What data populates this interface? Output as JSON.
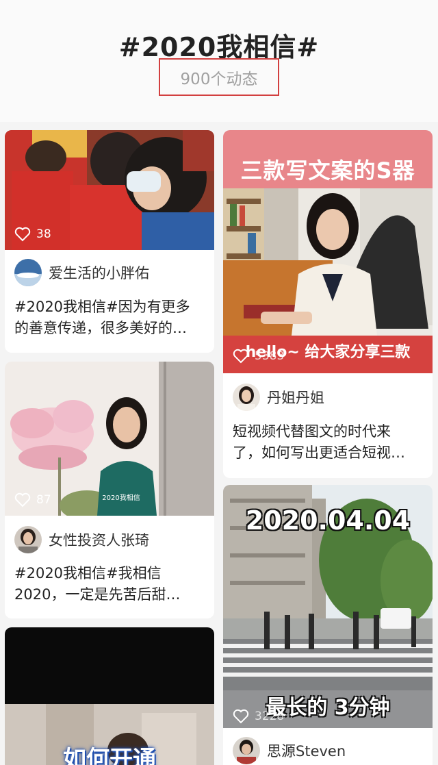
{
  "topic": {
    "title": "#2020我相信#",
    "post_count": "900个动态"
  },
  "left_column": [
    {
      "likes": "38",
      "author": "爱生活的小胖佑",
      "caption_lines": [
        "#2020我相信#因为有更多",
        "的善意传递，很多美好的…"
      ]
    },
    {
      "likes": "87",
      "video_tag": "2020我相信",
      "author": "女性投资人张琦",
      "caption_lines": [
        "#2020我相信#我相信",
        "2020，一定是先苦后甜…"
      ]
    },
    {
      "overlay_text": "如何开通"
    }
  ],
  "right_column": [
    {
      "banner_text": "三款写文案的S器",
      "bottom_text": "hello~ 给大家分享三款",
      "likes": "5383",
      "author": "丹姐丹姐",
      "caption_lines": [
        "短视频代替图文的时代来",
        "了，如何写出更适合短视…"
      ]
    },
    {
      "date_text": "2020.04.04",
      "bottom_text": "最长的 3分钟",
      "likes": "3228",
      "author": "思源Steven"
    }
  ],
  "icons": {
    "like": "heart-outline-icon"
  },
  "colors": {
    "highlight_border": "#d23f3f",
    "banner_pink": "#e8868a",
    "bottom_banner_red": "#d5423f"
  }
}
